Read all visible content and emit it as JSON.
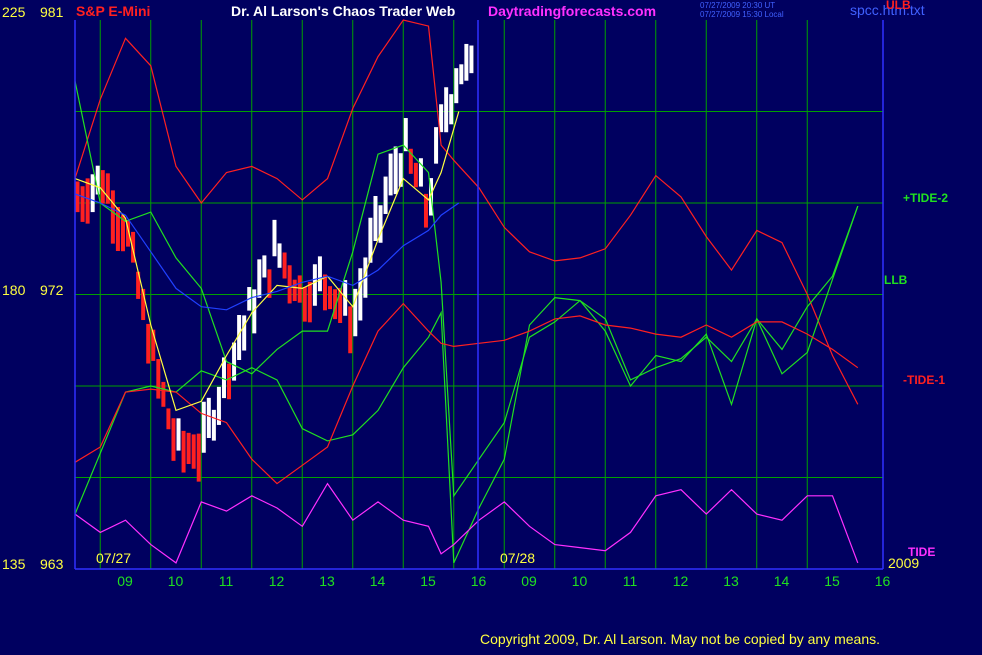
{
  "header": {
    "instrument": "S&P E-Mini",
    "title": "Dr. Al Larson's Chaos Trader Web",
    "site": "Daytradingforecasts.com",
    "stamp_ut": "07/27/2009 20:30 UT",
    "stamp_local": "07/27/2009 15:30 Local",
    "file": "spcc.htm.txt",
    "ulb_label": "ULB"
  },
  "left_axis": {
    "top_left": "225",
    "top_right": "981",
    "mid_left": "180",
    "mid_right": "972",
    "bot_left": "135",
    "bot_right": "963"
  },
  "dates": {
    "day1": "07/27",
    "day2": "07/28",
    "year": "2009"
  },
  "right_labels": {
    "tide2": "+TIDE-2",
    "llb": "LLB",
    "tide1": "-TIDE-1",
    "tide": "TIDE"
  },
  "footer": {
    "copyright": "Copyright 2009, Dr. Al Larson. May not be copied by any means."
  },
  "colors": {
    "background": "#000060",
    "grid": "#00a000",
    "axis": "#3030ff",
    "red": "#ff2020",
    "green": "#20e020",
    "magenta": "#ff30ff",
    "white": "#ffffff",
    "yellow": "#ffff40"
  },
  "chart_data": {
    "type": "line",
    "title": "S&P E-Mini",
    "x_ticks": [
      "09",
      "10",
      "11",
      "12",
      "13",
      "14",
      "15",
      "16",
      "09",
      "10",
      "11",
      "12",
      "13",
      "14",
      "15",
      "16"
    ],
    "x": [
      0,
      0.5,
      1,
      1.5,
      2,
      2.5,
      3,
      3.5,
      4,
      4.5,
      5,
      5.5,
      6,
      6.5,
      7,
      7.25,
      7.5,
      8,
      8.5,
      9,
      9.5,
      10,
      10.5,
      11,
      11.5,
      12,
      12.5,
      13,
      13.5,
      14,
      14.5,
      15,
      15.5
    ],
    "x_unit": "hours after 08:30 on 07/27 (second session begins at 7.25)",
    "ylim_price": [
      963,
      981
    ],
    "series": [
      {
        "name": "ULB",
        "values": [
          975.8,
          978.4,
          980.4,
          979.5,
          976.2,
          975.0,
          976.0,
          976.2,
          975.8,
          975.1,
          975.8,
          978.1,
          979.8,
          981.0,
          980.8,
          976.9,
          976.4,
          975.5,
          974.2,
          973.4,
          973.1,
          973.2,
          973.5,
          974.6,
          975.9,
          975.2,
          973.9,
          972.8,
          974.1,
          973.7,
          972.0,
          970.0,
          968.4
        ]
      },
      {
        "name": "+TIDE-2",
        "values": [
          979.0,
          975.0,
          974.4,
          974.7,
          973.2,
          972.2,
          969.8,
          969.4,
          970.2,
          970.8,
          970.8,
          973.4,
          976.6,
          976.9,
          976.0,
          972.4,
          965.4,
          966.6,
          967.8,
          970.6,
          971.1,
          971.8,
          971.2,
          969.2,
          969.6,
          969.9,
          970.6,
          969.8,
          971.2,
          969.4,
          970.1,
          972.5,
          974.9
        ]
      },
      {
        "name": "LLB",
        "values": [
          964.8,
          966.8,
          968.8,
          969.0,
          968.8,
          969.5,
          969.2,
          969.6,
          969.2,
          967.6,
          967.2,
          967.4,
          968.2,
          969.6,
          970.6,
          971.4,
          963.2,
          965.0,
          966.6,
          971.0,
          971.9,
          971.8,
          970.8,
          969.0,
          970.0,
          969.8,
          970.7,
          968.4,
          971.2,
          970.2,
          971.6,
          972.6,
          974.9
        ]
      },
      {
        "name": "-TIDE-1",
        "values": [
          966.5,
          967.0,
          968.8,
          968.9,
          968.8,
          968.1,
          967.8,
          966.6,
          965.8,
          966.4,
          967.0,
          969.0,
          970.8,
          971.7,
          970.8,
          970.4,
          970.3,
          970.4,
          970.5,
          970.8,
          971.2,
          971.3,
          971.0,
          970.9,
          970.7,
          970.6,
          971.0,
          970.6,
          971.1,
          971.1,
          970.7,
          970.2,
          969.6
        ]
      },
      {
        "name": "TIDE",
        "values": [
          964.8,
          964.2,
          964.6,
          963.8,
          963.2,
          965.2,
          964.9,
          965.4,
          965.0,
          964.4,
          965.8,
          964.6,
          965.2,
          964.6,
          964.4,
          963.5,
          963.8,
          964.6,
          965.2,
          964.4,
          963.8,
          963.7,
          963.6,
          964.2,
          965.4,
          965.6,
          964.8,
          965.6,
          964.8,
          964.6,
          965.4,
          965.4,
          963.2
        ]
      }
    ]
  }
}
